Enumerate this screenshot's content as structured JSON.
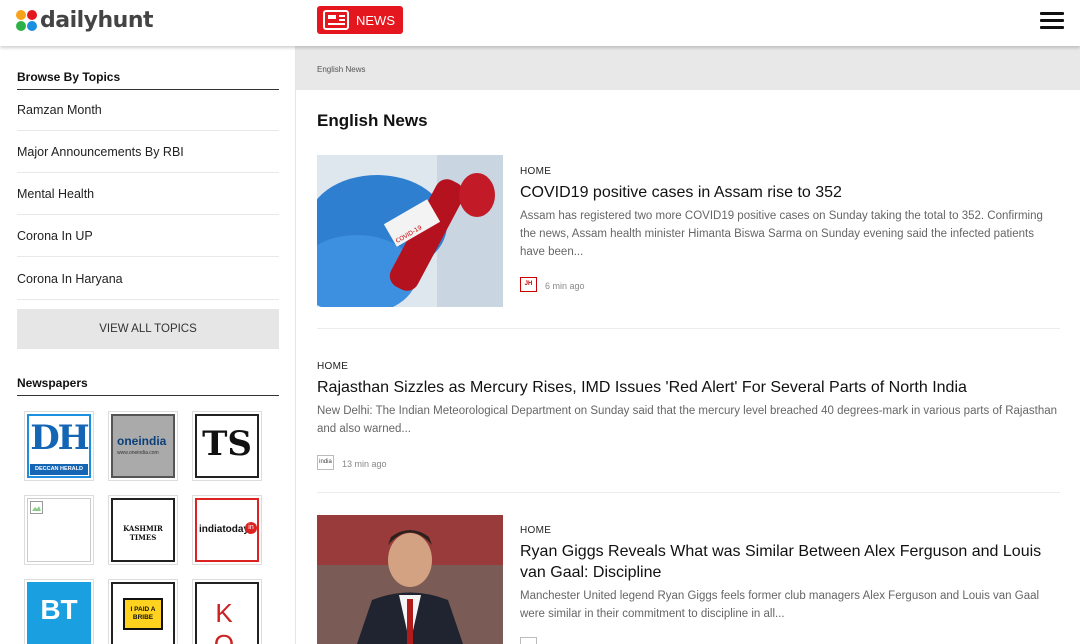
{
  "header": {
    "logo_text": "dailyhunt",
    "news_button_label": "NEWS",
    "icons": [
      "news-icon",
      "hamburger-menu-icon"
    ],
    "accent_color": "#e4161e"
  },
  "sidebar": {
    "topics_title": "Browse By Topics",
    "topics": [
      "Ramzan Month",
      "Major Announcements By RBI",
      "Mental Health",
      "Corona In UP",
      "Corona In Haryana"
    ],
    "view_all_label": "VIEW ALL TOPICS",
    "newspapers_title": "Newspapers",
    "newspapers": [
      {
        "text": "DH",
        "sub": "DECCAN HERALD"
      },
      {
        "text": "oneindia",
        "sub": "www.oneindia.com"
      },
      {
        "text": "TS",
        "sub": ""
      },
      {
        "text": "",
        "sub": ""
      },
      {
        "text": "KASHMIR TIMES",
        "sub": ""
      },
      {
        "text": "indiatoday",
        "sub": "in"
      },
      {
        "text": "BT",
        "sub": ""
      },
      {
        "text": "I PAID A BRIBE",
        "sub": ""
      },
      {
        "text": "K O",
        "sub": ""
      }
    ]
  },
  "main": {
    "breadcrumb": "English News",
    "title": "English News",
    "articles": [
      {
        "kicker": "HOME",
        "headline": "COVID19 positive cases in Assam rise to 352",
        "excerpt": "Assam has registered two more COVID19 positive cases on Sunday taking the total to 352. Confirming the news, Assam health minister Himanta Biswa Sarma on Sunday evening said the infected patients have been...",
        "source_icon": "JH",
        "time": "6 min ago"
      },
      {
        "kicker": "HOME",
        "headline": "Rajasthan Sizzles as Mercury Rises, IMD Issues 'Red Alert' For Several Parts of North India",
        "excerpt": "New Delhi: The Indian Meteorological Department on Sunday said that the mercury level breached 40 degrees-mark in various parts of Rajasthan and also warned...",
        "source_icon": "india",
        "time": "13 min ago"
      },
      {
        "kicker": "HOME",
        "headline": "Ryan Giggs Reveals What was Similar Between Alex Ferguson and Louis van Gaal: Discipline",
        "excerpt": "Manchester United legend Ryan Giggs feels former club managers Alex Ferguson and Louis van Gaal were similar in their commitment to discipline in all...",
        "source_icon": "",
        "time": ""
      }
    ]
  }
}
